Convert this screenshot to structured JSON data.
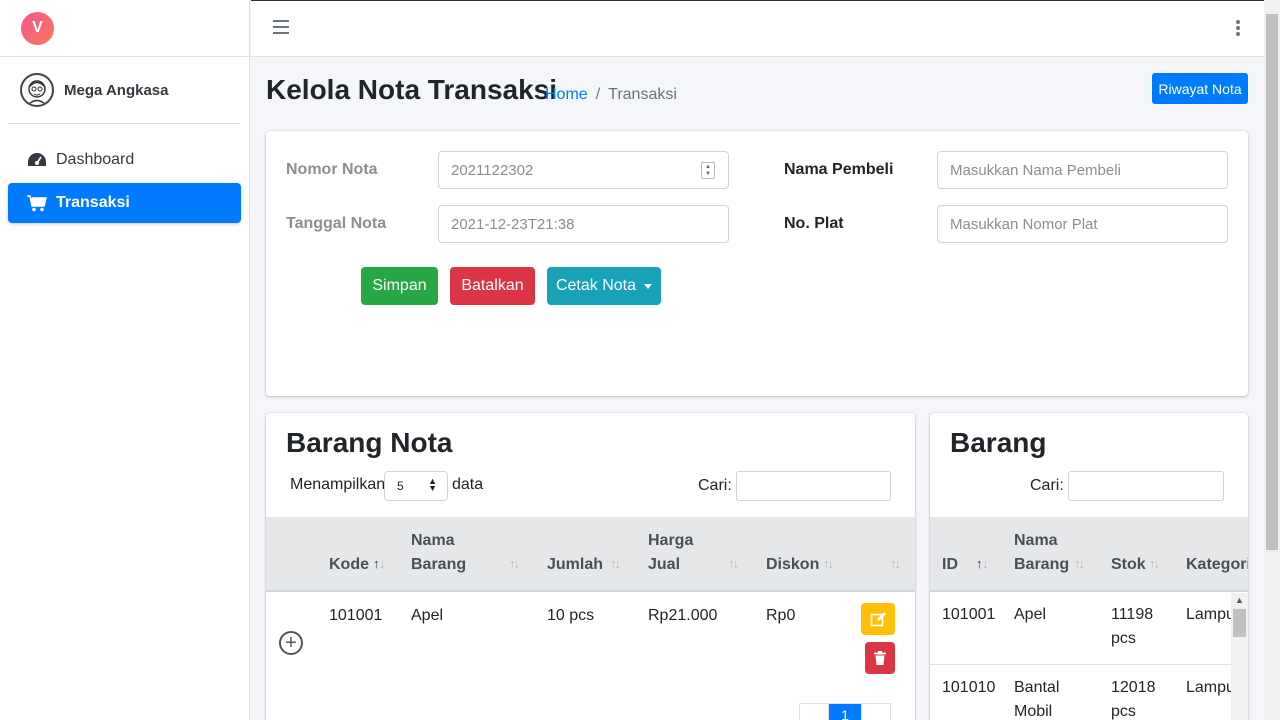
{
  "brand": {
    "logo_letter": "V"
  },
  "user": {
    "name": "Mega Angkasa"
  },
  "sidebar": {
    "items": [
      {
        "label": "Dashboard",
        "icon": "tachometer-icon",
        "active": false
      },
      {
        "label": "Transaksi",
        "icon": "cart-icon",
        "active": true
      }
    ]
  },
  "header": {
    "title": "Kelola Nota Transaksi",
    "breadcrumb": {
      "home": "Home",
      "sep": "/",
      "current": "Transaksi"
    },
    "riwayat_button": "Riwayat Nota"
  },
  "form": {
    "nomor_nota_label": "Nomor Nota",
    "nomor_nota_value": "2021122302",
    "tanggal_nota_label": "Tanggal Nota",
    "tanggal_nota_value": "2021-12-23T21:38",
    "nama_pembeli_label": "Nama Pembeli",
    "nama_pembeli_placeholder": "Masukkan Nama Pembeli",
    "no_plat_label": "No. Plat",
    "no_plat_placeholder": "Masukkan Nomor Plat",
    "simpan": "Simpan",
    "batalkan": "Batalkan",
    "cetak": "Cetak Nota"
  },
  "nota_table": {
    "title": "Barang Nota",
    "show_prefix": "Menampilkan",
    "show_value": "5",
    "show_suffix": "data",
    "search_label": "Cari:",
    "columns": [
      "Kode",
      "Nama Barang",
      "Jumlah",
      "Harga Jual",
      "Diskon"
    ],
    "rows": [
      {
        "kode": "101001",
        "nama": "Apel",
        "jumlah": "10 pcs",
        "harga": "Rp21.000",
        "diskon": "Rp0"
      }
    ],
    "pagination_current": "1"
  },
  "barang_table": {
    "title": "Barang",
    "search_label": "Cari:",
    "columns": [
      "ID",
      "Nama Barang",
      "Stok",
      "Kategori"
    ],
    "rows": [
      {
        "id": "101001",
        "nama": "Apel",
        "stok": "11198 pcs",
        "kategori": "Lampu"
      },
      {
        "id": "101010",
        "nama": "Bantal Mobil",
        "stok": "12018 pcs",
        "kategori": "Lampu"
      }
    ]
  },
  "colors": {
    "primary": "#007bff",
    "success": "#28a745",
    "danger": "#dc3545",
    "info": "#17a2b8",
    "warning": "#ffc107"
  }
}
